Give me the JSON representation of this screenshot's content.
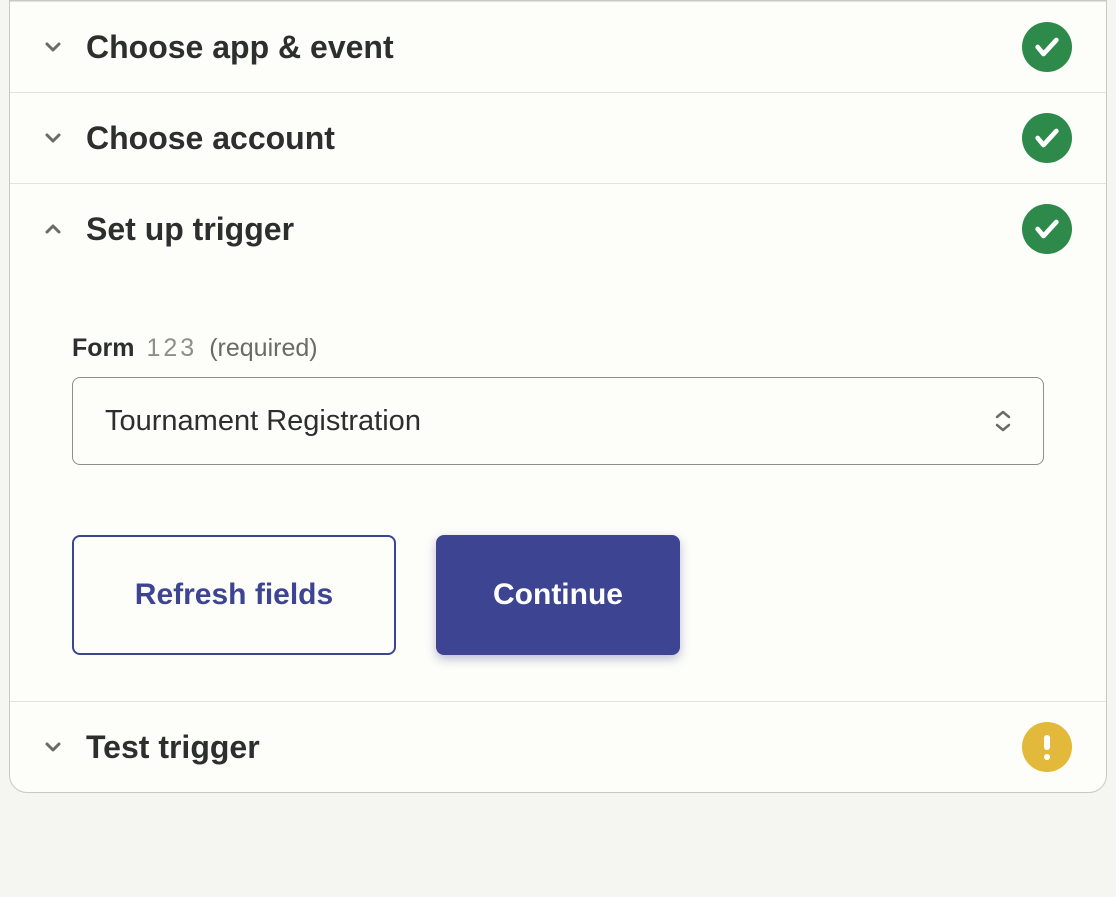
{
  "sections": {
    "app_event": {
      "title": "Choose app & event",
      "status": "success"
    },
    "account": {
      "title": "Choose account",
      "status": "success"
    },
    "setup": {
      "title": "Set up trigger",
      "status": "success"
    },
    "test": {
      "title": "Test trigger",
      "status": "warn"
    }
  },
  "form_field": {
    "label": "Form",
    "hint": "123",
    "required_text": "(required)",
    "value": "Tournament Registration"
  },
  "buttons": {
    "refresh": "Refresh fields",
    "continue": "Continue"
  }
}
